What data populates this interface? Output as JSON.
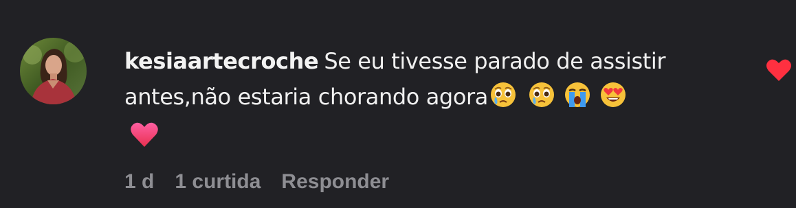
{
  "comment": {
    "username": "kesiaartecroche",
    "text": "Se eu tivesse parado de assistir antes,não estaria chorando agora",
    "emojis": [
      "pleading-face-tears",
      "pleading-face-tears",
      "loudly-crying-face",
      "heart-eyes-face",
      "pink-heart"
    ],
    "meta": {
      "time": "1 d",
      "likes": "1 curtida",
      "reply": "Responder"
    }
  },
  "colors": {
    "background": "#212125",
    "text": "#f4f4f4",
    "meta": "#8e8e93",
    "like_heart": "#ff3040"
  }
}
